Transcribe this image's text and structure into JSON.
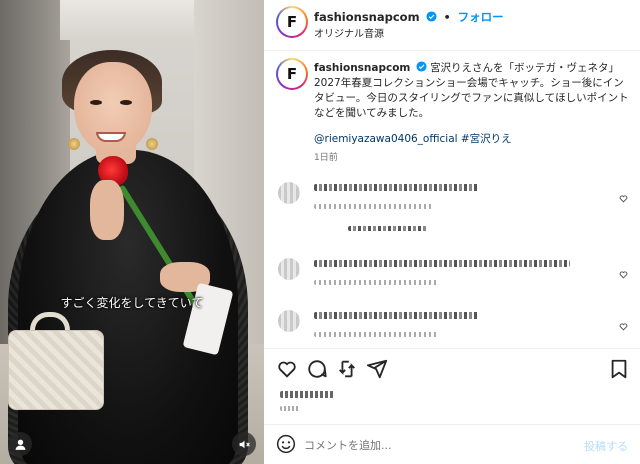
{
  "media": {
    "subtitle": "すごく変化をしてきていて"
  },
  "header": {
    "avatar_letter": "F",
    "username": "fashionsnapcom",
    "separator": "•",
    "follow_label": "フォロー",
    "audio_label": "オリジナル音源"
  },
  "caption": {
    "avatar_letter": "F",
    "username": "fashionsnapcom",
    "text": "宮沢りえさんを「ボッテガ・ヴェネタ」2027年春夏コレクションショー会場でキャッチ。ショー後にインタビュー。今日のスタイリングでファンに真似してほしいポイントなどを聞いてみました。",
    "tags": "@riemiyazawa0406_official #宮沢りえ",
    "time": "1日前"
  },
  "comment_box": {
    "placeholder": "コメントを追加...",
    "post_label": "投稿する"
  },
  "colors": {
    "accent": "#0095f6",
    "link": "#00376b",
    "muted": "#737373"
  }
}
